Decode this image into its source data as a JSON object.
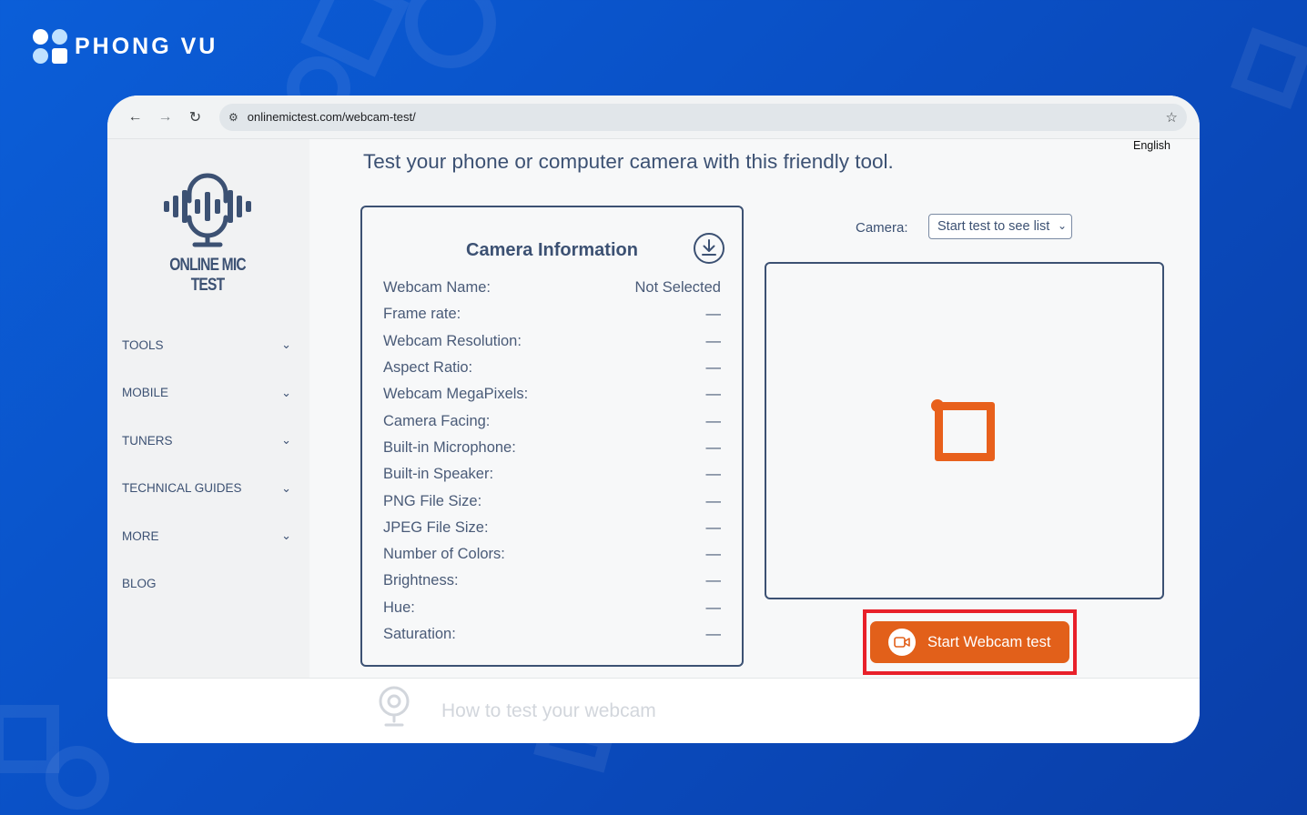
{
  "brand": {
    "name": "PHONG VU"
  },
  "browser": {
    "url": "onlinemictest.com/webcam-test/",
    "back_icon": "←",
    "forward_icon": "→",
    "reload_icon": "↻",
    "site_info_icon": "⚙",
    "bookmark_icon": "☆"
  },
  "site": {
    "logo_text": "ONLINE MIC TEST",
    "language": "English",
    "headline": "Test your phone or computer camera with this friendly tool."
  },
  "sidebar": {
    "items": [
      {
        "label": "TOOLS",
        "has_chevron": true
      },
      {
        "label": "MOBILE",
        "has_chevron": true
      },
      {
        "label": "TUNERS",
        "has_chevron": true
      },
      {
        "label": "TECHNICAL GUIDES",
        "has_chevron": true
      },
      {
        "label": "MORE",
        "has_chevron": true
      },
      {
        "label": "BLOG",
        "has_chevron": false
      }
    ]
  },
  "camera_info": {
    "title": "Camera Information",
    "rows": [
      {
        "label": "Webcam Name:",
        "value": "Not Selected"
      },
      {
        "label": "Frame rate:",
        "value": "—"
      },
      {
        "label": "Webcam Resolution:",
        "value": "—"
      },
      {
        "label": "Aspect Ratio:",
        "value": "—"
      },
      {
        "label": "Webcam MegaPixels:",
        "value": "—"
      },
      {
        "label": "Camera Facing:",
        "value": "—"
      },
      {
        "label": "Built-in Microphone:",
        "value": "—"
      },
      {
        "label": "Built-in Speaker:",
        "value": "—"
      },
      {
        "label": "PNG File Size:",
        "value": "—"
      },
      {
        "label": "JPEG File Size:",
        "value": "—"
      },
      {
        "label": "Number of Colors:",
        "value": "—"
      },
      {
        "label": "Brightness:",
        "value": "—"
      },
      {
        "label": "Hue:",
        "value": "—"
      },
      {
        "label": "Saturation:",
        "value": "—"
      }
    ]
  },
  "camera_select": {
    "label": "Camera:",
    "selected": "Start test to see list"
  },
  "start_button": {
    "label": "Start Webcam test"
  },
  "footer": {
    "title": "How to test your webcam"
  },
  "colors": {
    "accent": "#e2601a",
    "highlight": "#e8202a",
    "text": "#3c5173",
    "background": "#0b5ed8"
  }
}
